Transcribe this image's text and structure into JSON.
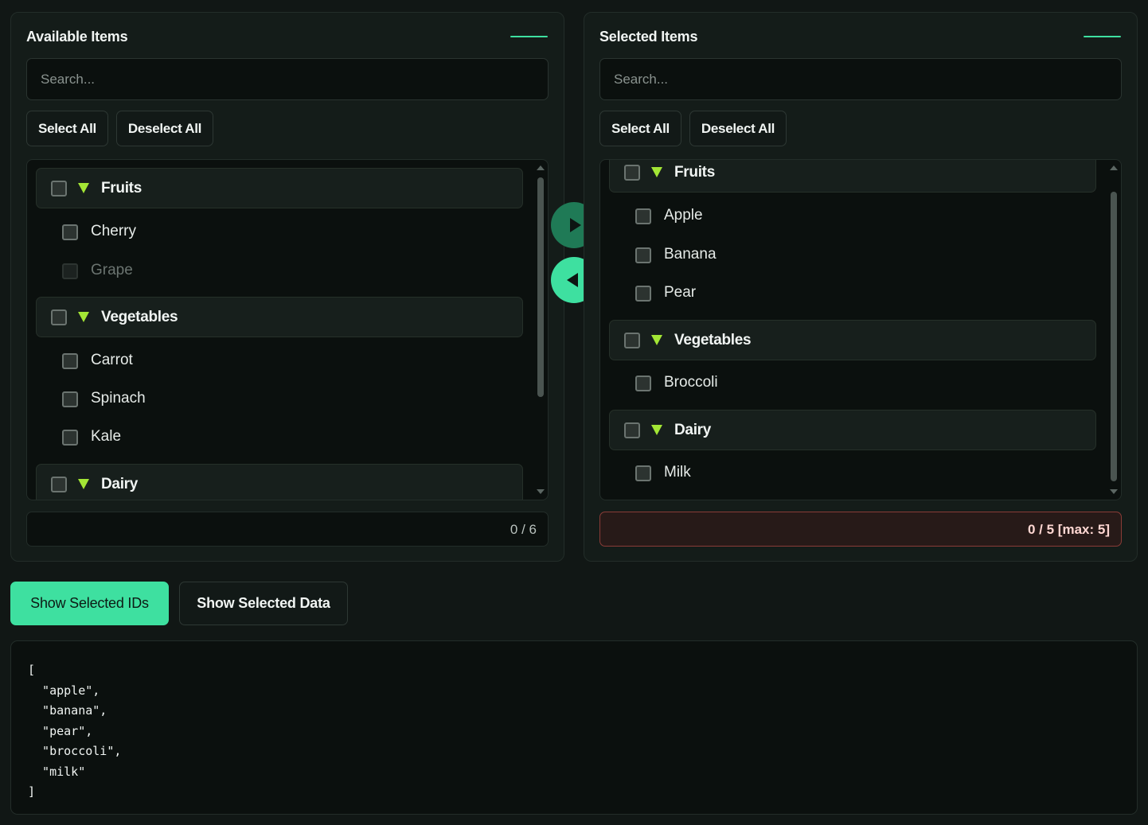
{
  "left_panel": {
    "title": "Available Items",
    "search_placeholder": "Search...",
    "select_all_label": "Select All",
    "deselect_all_label": "Deselect All",
    "groups": [
      {
        "label": "Fruits",
        "items": [
          {
            "label": "Cherry",
            "disabled": false
          },
          {
            "label": "Grape",
            "disabled": true
          }
        ]
      },
      {
        "label": "Vegetables",
        "items": [
          {
            "label": "Carrot",
            "disabled": false
          },
          {
            "label": "Spinach",
            "disabled": false
          },
          {
            "label": "Kale",
            "disabled": false
          }
        ]
      },
      {
        "label": "Dairy",
        "items": []
      }
    ],
    "counter": "0 / 6"
  },
  "right_panel": {
    "title": "Selected Items",
    "search_placeholder": "Search...",
    "select_all_label": "Select All",
    "deselect_all_label": "Deselect All",
    "groups": [
      {
        "label": "Fruits",
        "items": [
          {
            "label": "Apple",
            "disabled": false
          },
          {
            "label": "Banana",
            "disabled": false
          },
          {
            "label": "Pear",
            "disabled": false
          }
        ]
      },
      {
        "label": "Vegetables",
        "items": [
          {
            "label": "Broccoli",
            "disabled": false
          }
        ]
      },
      {
        "label": "Dairy",
        "items": [
          {
            "label": "Milk",
            "disabled": false
          }
        ]
      }
    ],
    "counter": "0 / 5 [max: 5]"
  },
  "actions": {
    "show_ids_label": "Show Selected IDs",
    "show_data_label": "Show Selected Data"
  },
  "output_text": "[\n  \"apple\",\n  \"banana\",\n  \"pear\",\n  \"broccoli\",\n  \"milk\"\n]",
  "colors": {
    "accent": "#3ee0a0",
    "accent_dark": "#1f7a56",
    "triangle": "#a3e635",
    "limit_border": "#8a3c37"
  },
  "icons": {
    "group_toggle": "triangle-down-icon",
    "move_right": "play-right-icon",
    "move_left": "play-left-icon"
  }
}
